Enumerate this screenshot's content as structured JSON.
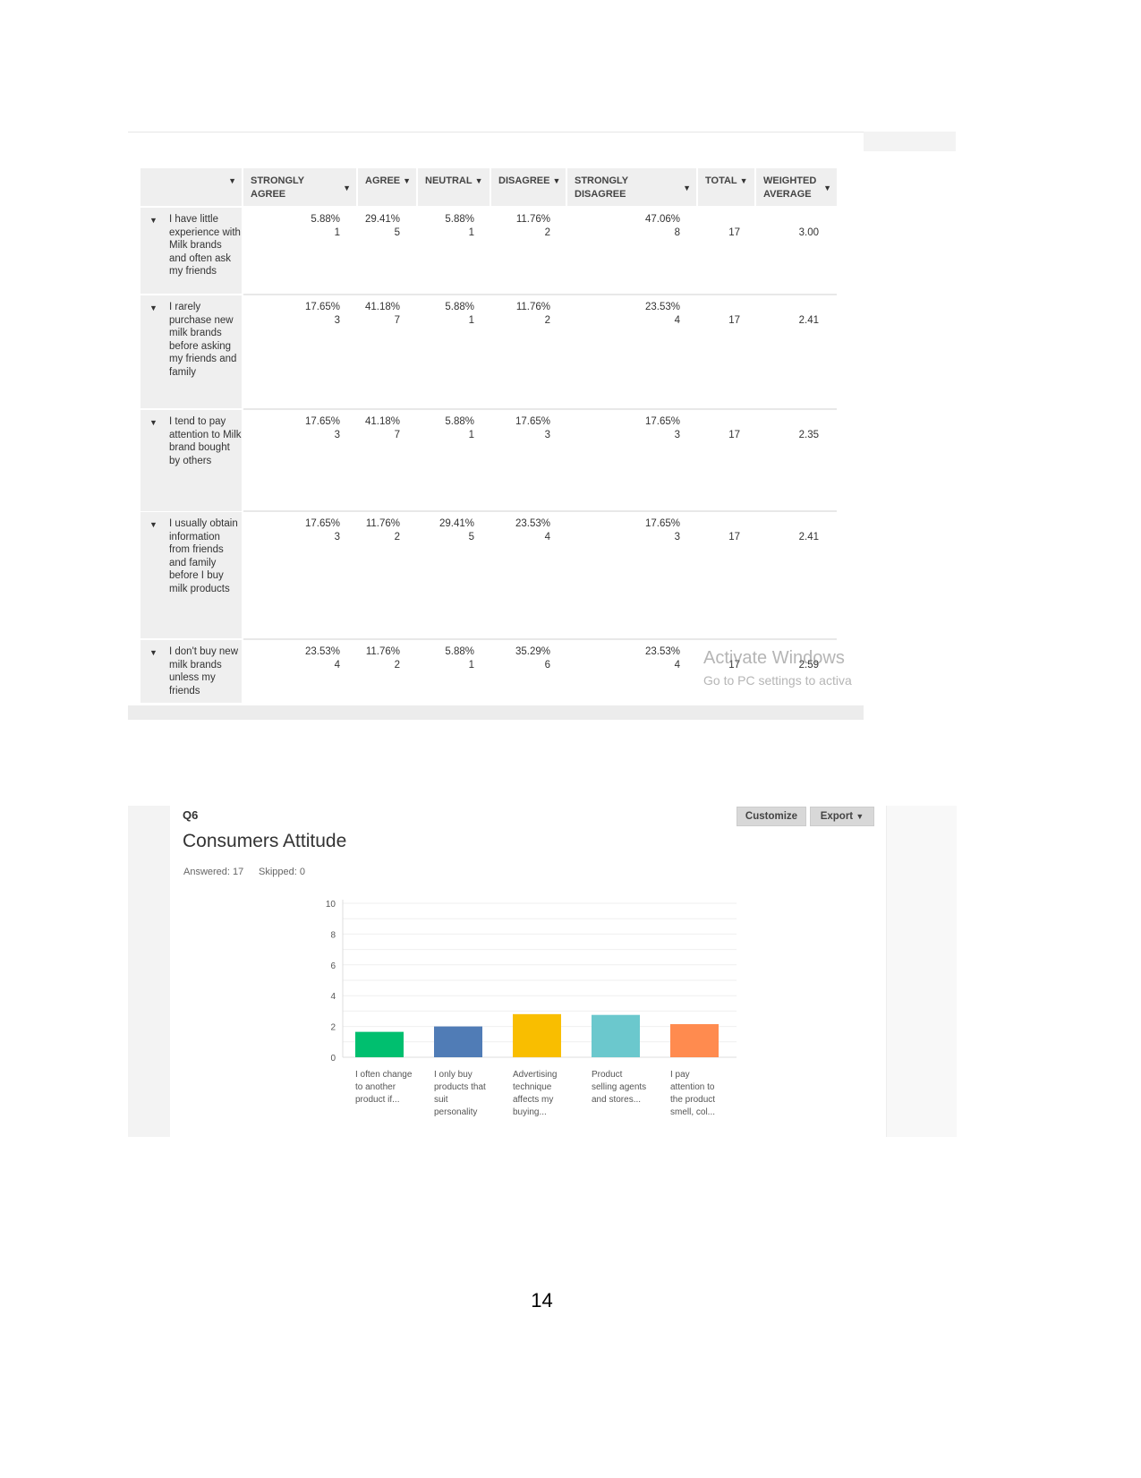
{
  "table": {
    "columns": [
      "",
      "STRONGLY AGREE",
      "AGREE",
      "NEUTRAL",
      "DISAGREE",
      "STRONGLY DISAGREE",
      "TOTAL",
      "WEIGHTED AVERAGE"
    ],
    "rows": [
      {
        "label": "I have little experience with Milk brands and often ask my friends",
        "cells": [
          [
            "5.88%",
            "1"
          ],
          [
            "29.41%",
            "5"
          ],
          [
            "5.88%",
            "1"
          ],
          [
            "11.76%",
            "2"
          ],
          [
            "47.06%",
            "8"
          ]
        ],
        "total": "17",
        "avg": "3.00"
      },
      {
        "label": "I rarely purchase new milk brands before asking my friends and family",
        "cells": [
          [
            "17.65%",
            "3"
          ],
          [
            "41.18%",
            "7"
          ],
          [
            "5.88%",
            "1"
          ],
          [
            "11.76%",
            "2"
          ],
          [
            "23.53%",
            "4"
          ]
        ],
        "total": "17",
        "avg": "2.41"
      },
      {
        "label": "I tend to pay attention to Milk brand bought by others",
        "cells": [
          [
            "17.65%",
            "3"
          ],
          [
            "41.18%",
            "7"
          ],
          [
            "5.88%",
            "1"
          ],
          [
            "17.65%",
            "3"
          ],
          [
            "17.65%",
            "3"
          ]
        ],
        "total": "17",
        "avg": "2.35"
      },
      {
        "label": "I usually obtain information from friends and family before I buy milk products",
        "cells": [
          [
            "17.65%",
            "3"
          ],
          [
            "11.76%",
            "2"
          ],
          [
            "29.41%",
            "5"
          ],
          [
            "23.53%",
            "4"
          ],
          [
            "17.65%",
            "3"
          ]
        ],
        "total": "17",
        "avg": "2.41"
      },
      {
        "label": "I don't buy new milk brands unless my friends",
        "cells": [
          [
            "23.53%",
            "4"
          ],
          [
            "11.76%",
            "2"
          ],
          [
            "5.88%",
            "1"
          ],
          [
            "35.29%",
            "6"
          ],
          [
            "23.53%",
            "4"
          ]
        ],
        "total": "17",
        "avg": "2.59"
      }
    ]
  },
  "watermark": {
    "line1": "Activate Windows",
    "line2": "Go to PC settings to activa"
  },
  "question": {
    "id": "Q6",
    "title": "Consumers Attitude",
    "answered": "Answered: 17",
    "skipped": "Skipped: 0",
    "customize": "Customize",
    "export": "Export"
  },
  "chart_data": {
    "type": "bar",
    "categories": [
      "I often change to another product if...",
      "I only buy products that suit personality",
      "Advertising technique affects my buying...",
      "Product selling agents and stores...",
      "I pay attention to the product smell, col..."
    ],
    "values": [
      1.65,
      2.0,
      2.8,
      2.75,
      2.15
    ],
    "colors": [
      "#00bf6f",
      "#507cb6",
      "#f9be00",
      "#6bc8cd",
      "#ff8b4f"
    ],
    "ylim": [
      0,
      10
    ],
    "yticks": [
      "0",
      "2",
      "4",
      "6",
      "8",
      "10"
    ],
    "grid": true
  },
  "page_number": "14"
}
